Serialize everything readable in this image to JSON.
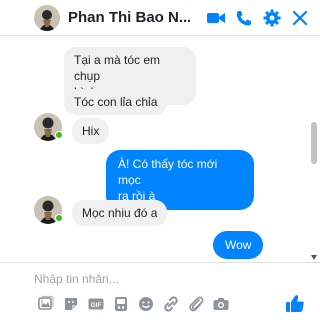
{
  "header": {
    "contact_name": "Phan Thi Bao N...",
    "icons": [
      "video-icon",
      "phone-icon",
      "gear-icon",
      "close-icon"
    ]
  },
  "messages": [
    {
      "side": "in",
      "text_lines": [
        "Tại a mà tóc em chụp",
        "hình"
      ]
    },
    {
      "side": "in",
      "text_lines": [
        "Tóc con lỉa chỉa"
      ]
    },
    {
      "side": "in",
      "text_lines": [
        "Hix"
      ]
    },
    {
      "side": "out",
      "text_lines": [
        "À! Có thấy tóc mới mọc",
        "ra rồi à"
      ]
    },
    {
      "side": "in",
      "text_lines": [
        "Mọc nhiu đó a"
      ]
    },
    {
      "side": "out",
      "text_lines": [
        "Wow"
      ]
    }
  ],
  "composer": {
    "placeholder": "Nhập tin nhắn...",
    "toolbar_icons": [
      "image-icon",
      "sticker-icon",
      "gif-icon",
      "game-icon",
      "emoji-icon",
      "link-icon",
      "attachment-icon",
      "camera-icon"
    ],
    "send_icon": "like-icon"
  },
  "colors": {
    "accent": "#0084ff",
    "incoming_bubble": "#f1f0f0",
    "online": "#42b72a",
    "brand": "#1877f2"
  }
}
